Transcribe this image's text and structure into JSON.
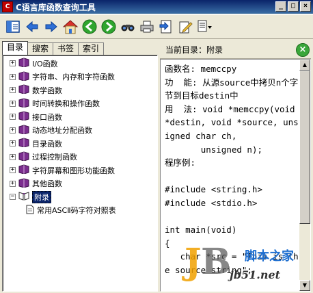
{
  "window": {
    "title": "C语言库函数查询工具",
    "icon_text": "C",
    "min_label": "_",
    "max_label": "□",
    "close_label": "×"
  },
  "toolbar": {
    "items": [
      "show-hide-icon",
      "back-icon",
      "forward-icon",
      "home-icon",
      "nav-back-icon",
      "nav-forward-icon",
      "find-icon",
      "print-icon",
      "bookmark-icon",
      "edit-icon",
      "options-icon"
    ]
  },
  "left": {
    "tabs": [
      "目录",
      "搜索",
      "书签",
      "索引"
    ],
    "tree": [
      {
        "label": "I/O函数",
        "expander": "+"
      },
      {
        "label": "字符串、内存和字符函数",
        "expander": "+"
      },
      {
        "label": "数学函数",
        "expander": "+"
      },
      {
        "label": "时间转换和操作函数",
        "expander": "+"
      },
      {
        "label": "接口函数",
        "expander": "+"
      },
      {
        "label": "动态地址分配函数",
        "expander": "+"
      },
      {
        "label": "目录函数",
        "expander": "+"
      },
      {
        "label": "过程控制函数",
        "expander": "+"
      },
      {
        "label": "字符屏幕和图形功能函数",
        "expander": "+"
      },
      {
        "label": "其他函数",
        "expander": "+"
      },
      {
        "label": "附录",
        "expander": "−",
        "selected": true
      }
    ],
    "leaf": "常用ASCⅡ码字符对照表"
  },
  "right": {
    "header": "当前目录：附录",
    "close_label": "×",
    "content": "函数名: memccpy\n功  能: 从源source中拷贝n个字节到目标destin中\n用  法: void *memccpy(void *destin, void *source, unsigned char ch,\n       unsigned n);\n程序例:\n\n#include <string.h>\n#include <stdio.h>\n\nint main(void)\n{\n   char *src = \"This is the source string\";"
  },
  "watermark": {
    "cn": "脚本之家",
    "url": "jb51.net",
    "logo_j": "J",
    "logo_b": "B"
  },
  "colors": {
    "title_bar": "#0a246a",
    "selection": "#0a246a",
    "book_purple": "#7b2d8e",
    "close_green": "#3aa63a"
  }
}
